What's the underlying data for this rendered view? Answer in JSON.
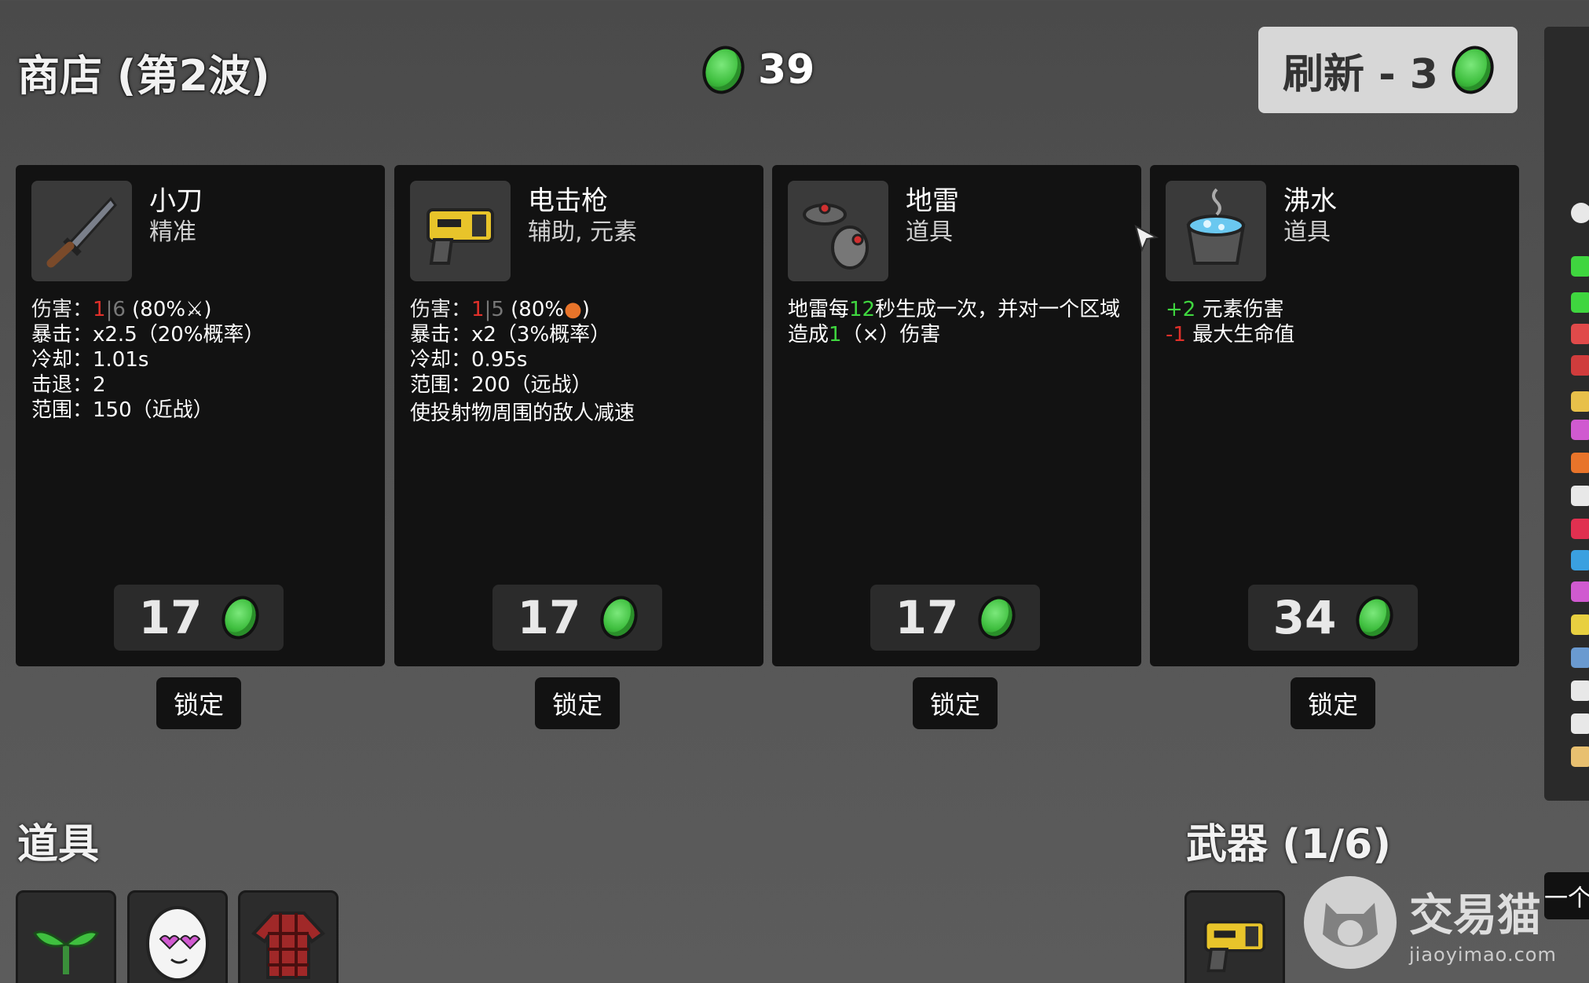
{
  "header": {
    "title": "商店 (第2波)",
    "materials": "39",
    "refresh_label": "刷新 - 3"
  },
  "shop_items": [
    {
      "name": "小刀",
      "tags": "精准",
      "icon": "knife-icon",
      "stats": {
        "damage_key": "伤害：",
        "damage_base": "1",
        "damage_sep": "|",
        "damage_scaled": "6",
        "damage_pct": "(80%",
        "damage_close": ")",
        "crit": "暴击：x2.5（20%概率）",
        "cooldown": "冷却：1.01s",
        "knockback": "击退：2",
        "range": "范围：150（近战）"
      },
      "price": "17",
      "lock_label": "锁定"
    },
    {
      "name": "电击枪",
      "tags": "辅助, 元素",
      "icon": "taser-icon",
      "stats": {
        "damage_key": "伤害：",
        "damage_base": "1",
        "damage_sep": "|",
        "damage_scaled": "5",
        "damage_pct": "(80%",
        "damage_close": ")",
        "crit": "暴击：x2（3%概率）",
        "cooldown": "冷却：0.95s",
        "range": "范围：200（远战）",
        "effect": "使投射物周围的敌人减速"
      },
      "price": "17",
      "lock_label": "锁定"
    },
    {
      "name": "地雷",
      "tags": "道具",
      "icon": "landmine-icon",
      "desc_line1_a": "地雷每",
      "desc_line1_num": "12",
      "desc_line1_b": "秒生成一次，并对一个区域",
      "desc_line2_a": "造成",
      "desc_line2_num": "1",
      "desc_line2_b": "（⨯）伤害",
      "price": "17",
      "lock_label": "锁定"
    },
    {
      "name": "沸水",
      "tags": "道具",
      "icon": "boiling-water-icon",
      "effect1_val": "+2",
      "effect1_txt": " 元素伤害",
      "effect2_val": "-1",
      "effect2_txt": " 最大生命值",
      "price": "34",
      "lock_label": "锁定"
    }
  ],
  "items_section": {
    "title": "道具",
    "items": [
      "sprout-icon",
      "egg-icon",
      "plaid-shirt-icon"
    ]
  },
  "weapons_section": {
    "title": "武器 (1/6)",
    "items": [
      "taser-icon"
    ]
  },
  "watermark": {
    "cn": "交易猫",
    "en": "jiaoyimao.com"
  },
  "tooltip_tab": "一个",
  "colors": {
    "material_green": "#3fbf3f",
    "positive": "#3fd63f",
    "negative": "#e0302a",
    "card_bg": "#121212"
  }
}
